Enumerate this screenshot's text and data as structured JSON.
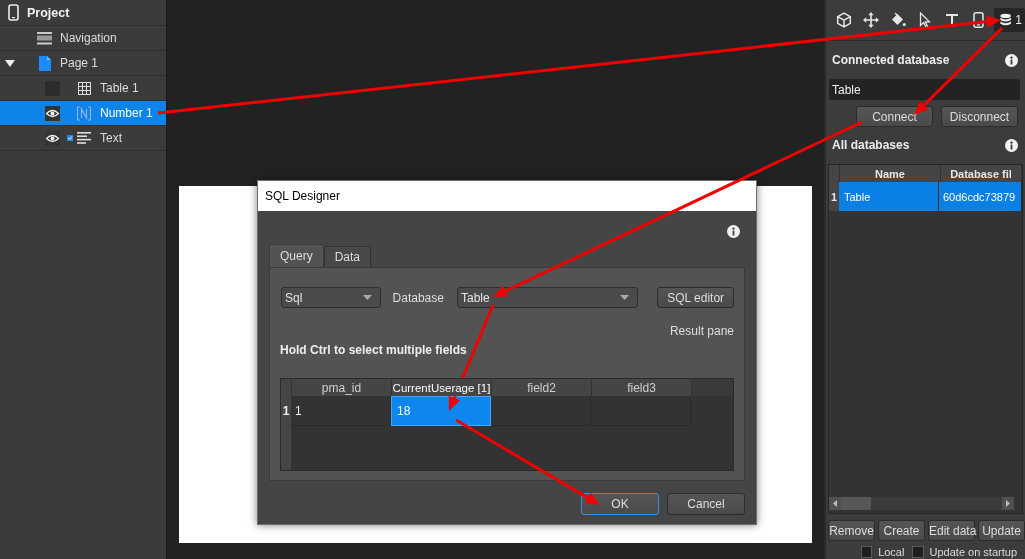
{
  "layers_panel": {
    "title": "Project",
    "items": [
      {
        "label": "Navigation",
        "kind": "navigation",
        "selected": false
      },
      {
        "label": "Page 1",
        "kind": "page",
        "selected": false,
        "expanded": true,
        "children": [
          {
            "label": "Table 1",
            "kind": "table",
            "selected": false,
            "visible": false,
            "checked": false
          },
          {
            "label": "Number 1",
            "kind": "number",
            "selected": true,
            "visible": true,
            "checked": false
          },
          {
            "label": "Text",
            "kind": "text",
            "selected": false,
            "visible": true,
            "checked": true
          }
        ]
      }
    ]
  },
  "toolbar": {
    "tools": [
      {
        "kind": "cube",
        "selected": false
      },
      {
        "kind": "move",
        "selected": false
      },
      {
        "kind": "fill",
        "selected": false
      },
      {
        "kind": "pointer",
        "selected": false
      },
      {
        "kind": "text",
        "selected": false
      },
      {
        "kind": "device",
        "selected": false
      },
      {
        "kind": "database",
        "selected": true,
        "count": "1"
      }
    ]
  },
  "database_panel": {
    "connected": {
      "title": "Connected database",
      "value": "Table"
    },
    "connect_buttons": [
      "Connect",
      "Disconnect"
    ],
    "databases": {
      "title": "All databases",
      "columns": [
        "Name",
        "Database fil"
      ],
      "rows": [
        {
          "index": "1",
          "selected": true,
          "cells": [
            "Table",
            "60d6cdc73879"
          ]
        }
      ]
    },
    "actions": [
      "Remove",
      "Create",
      "Edit data",
      "Update"
    ],
    "options": [
      {
        "label": "Local",
        "checked": false
      },
      {
        "label": "Update on startup",
        "checked": false
      }
    ]
  },
  "dialog": {
    "title": "SQL Designer",
    "tabs": [
      {
        "label": "Query",
        "selected": true
      },
      {
        "label": "Data",
        "selected": false
      }
    ],
    "query_type": "Sql",
    "database_label": "Database",
    "database": "Table",
    "sql_editor_button": "SQL editor",
    "result_pane": "Result pane",
    "hint": "Hold Ctrl to select multiple fields",
    "grid": {
      "columns": [
        {
          "label": "pma_id",
          "selected": false
        },
        {
          "label": "CurrentUserage [1]",
          "selected": true
        },
        {
          "label": "field2",
          "selected": false
        },
        {
          "label": "field3",
          "selected": false
        }
      ],
      "rows": [
        {
          "index": "1",
          "cells": [
            {
              "text": "1",
              "selected": false
            },
            {
              "text": "18",
              "selected": true
            },
            {
              "selected": false
            },
            {
              "selected": false
            }
          ]
        }
      ]
    },
    "buttons": [
      {
        "label": "OK",
        "kind": "default"
      },
      {
        "label": "Cancel",
        "kind": "normal"
      }
    ]
  }
}
